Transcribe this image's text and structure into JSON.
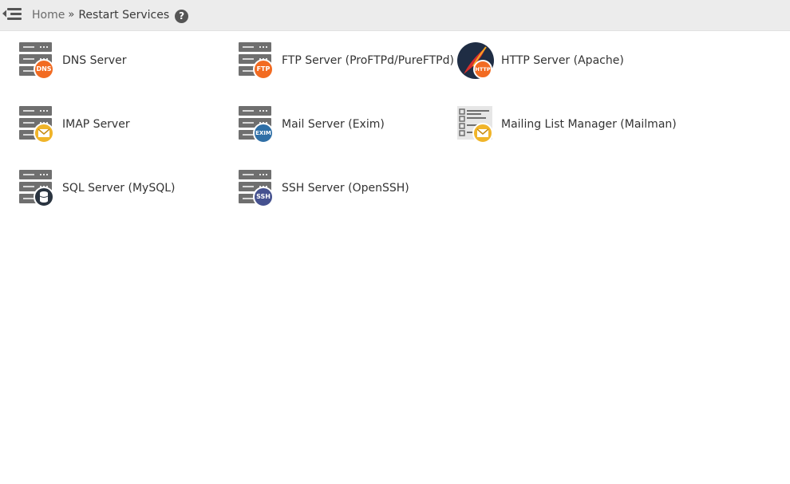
{
  "breadcrumb": {
    "home": "Home",
    "separator": "»",
    "current": "Restart Services",
    "help_glyph": "?"
  },
  "colors": {
    "topbar": "#ececec",
    "server_gray": "#6f6f6f",
    "badge_orange": "#f26b22",
    "badge_yellow": "#f0b429",
    "badge_blue": "#2f6fa6",
    "badge_indigo": "#45518f"
  },
  "services": [
    {
      "label": "DNS Server",
      "icon": "dns-server-icon",
      "badge": "DNS"
    },
    {
      "label": "FTP Server (ProFTPd/PureFTPd)",
      "icon": "ftp-server-icon",
      "badge": "FTP"
    },
    {
      "label": "HTTP Server (Apache)",
      "icon": "apache-feather-icon",
      "badge": "HTTP"
    },
    {
      "label": "IMAP Server",
      "icon": "imap-server-icon",
      "badge": ""
    },
    {
      "label": "Mail Server (Exim)",
      "icon": "exim-server-icon",
      "badge": "EXIM"
    },
    {
      "label": "Mailing List Manager (Mailman)",
      "icon": "mailing-list-icon",
      "badge": ""
    },
    {
      "label": "SQL Server (MySQL)",
      "icon": "mysql-server-icon",
      "badge": ""
    },
    {
      "label": "SSH Server (OpenSSH)",
      "icon": "ssh-server-icon",
      "badge": "SSH"
    }
  ]
}
